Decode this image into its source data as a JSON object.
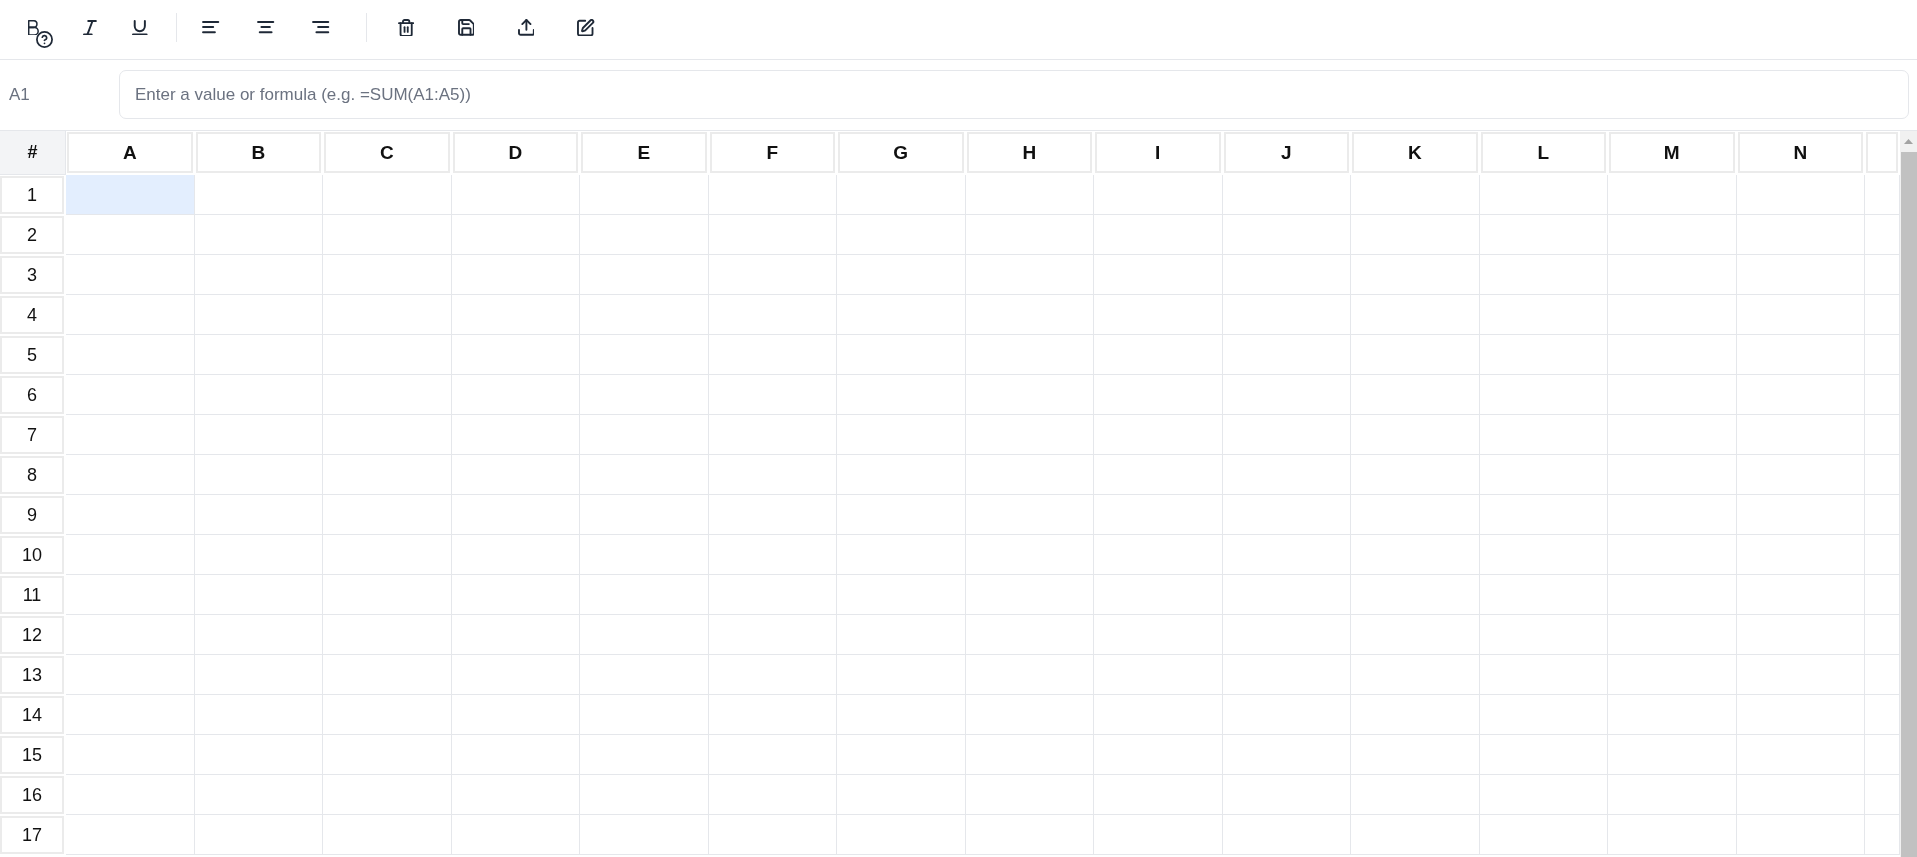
{
  "toolbar": {
    "groups": [
      {
        "buttons": [
          {
            "kind": "bold"
          },
          {
            "kind": "italic"
          },
          {
            "kind": "underline"
          }
        ]
      },
      {
        "buttons": [
          {
            "kind": "align-left"
          },
          {
            "kind": "align-center"
          },
          {
            "kind": "align-right"
          }
        ]
      },
      {
        "buttons": [
          {
            "kind": "delete"
          },
          {
            "kind": "save"
          },
          {
            "kind": "export"
          },
          {
            "kind": "edit"
          }
        ]
      }
    ]
  },
  "formula_bar": {
    "cell_reference": "A1",
    "placeholder": "Enter a value or formula (e.g. =SUM(A1:A5))"
  },
  "grid": {
    "corner": "#",
    "columns": [
      "A",
      "B",
      "C",
      "D",
      "E",
      "F",
      "G",
      "H",
      "I",
      "J",
      "K",
      "L",
      "M",
      "N"
    ],
    "rows": [
      {
        "label": "1",
        "cells": [
          {
            "selected": true
          },
          {
            "selected": false
          },
          {
            "selected": false
          },
          {
            "selected": false
          },
          {
            "selected": false
          },
          {
            "selected": false
          },
          {
            "selected": false
          },
          {
            "selected": false
          },
          {
            "selected": false
          },
          {
            "selected": false
          },
          {
            "selected": false
          },
          {
            "selected": false
          },
          {
            "selected": false
          },
          {
            "selected": false
          }
        ]
      },
      {
        "label": "2",
        "cells": [
          {
            "selected": false
          },
          {
            "selected": false
          },
          {
            "selected": false
          },
          {
            "selected": false
          },
          {
            "selected": false
          },
          {
            "selected": false
          },
          {
            "selected": false
          },
          {
            "selected": false
          },
          {
            "selected": false
          },
          {
            "selected": false
          },
          {
            "selected": false
          },
          {
            "selected": false
          },
          {
            "selected": false
          },
          {
            "selected": false
          }
        ]
      },
      {
        "label": "3",
        "cells": [
          {
            "selected": false
          },
          {
            "selected": false
          },
          {
            "selected": false
          },
          {
            "selected": false
          },
          {
            "selected": false
          },
          {
            "selected": false
          },
          {
            "selected": false
          },
          {
            "selected": false
          },
          {
            "selected": false
          },
          {
            "selected": false
          },
          {
            "selected": false
          },
          {
            "selected": false
          },
          {
            "selected": false
          },
          {
            "selected": false
          }
        ]
      },
      {
        "label": "4",
        "cells": [
          {
            "selected": false
          },
          {
            "selected": false
          },
          {
            "selected": false
          },
          {
            "selected": false
          },
          {
            "selected": false
          },
          {
            "selected": false
          },
          {
            "selected": false
          },
          {
            "selected": false
          },
          {
            "selected": false
          },
          {
            "selected": false
          },
          {
            "selected": false
          },
          {
            "selected": false
          },
          {
            "selected": false
          },
          {
            "selected": false
          }
        ]
      },
      {
        "label": "5",
        "cells": [
          {
            "selected": false
          },
          {
            "selected": false
          },
          {
            "selected": false
          },
          {
            "selected": false
          },
          {
            "selected": false
          },
          {
            "selected": false
          },
          {
            "selected": false
          },
          {
            "selected": false
          },
          {
            "selected": false
          },
          {
            "selected": false
          },
          {
            "selected": false
          },
          {
            "selected": false
          },
          {
            "selected": false
          },
          {
            "selected": false
          }
        ]
      },
      {
        "label": "6",
        "cells": [
          {
            "selected": false
          },
          {
            "selected": false
          },
          {
            "selected": false
          },
          {
            "selected": false
          },
          {
            "selected": false
          },
          {
            "selected": false
          },
          {
            "selected": false
          },
          {
            "selected": false
          },
          {
            "selected": false
          },
          {
            "selected": false
          },
          {
            "selected": false
          },
          {
            "selected": false
          },
          {
            "selected": false
          },
          {
            "selected": false
          }
        ]
      },
      {
        "label": "7",
        "cells": [
          {
            "selected": false
          },
          {
            "selected": false
          },
          {
            "selected": false
          },
          {
            "selected": false
          },
          {
            "selected": false
          },
          {
            "selected": false
          },
          {
            "selected": false
          },
          {
            "selected": false
          },
          {
            "selected": false
          },
          {
            "selected": false
          },
          {
            "selected": false
          },
          {
            "selected": false
          },
          {
            "selected": false
          },
          {
            "selected": false
          }
        ]
      },
      {
        "label": "8",
        "cells": [
          {
            "selected": false
          },
          {
            "selected": false
          },
          {
            "selected": false
          },
          {
            "selected": false
          },
          {
            "selected": false
          },
          {
            "selected": false
          },
          {
            "selected": false
          },
          {
            "selected": false
          },
          {
            "selected": false
          },
          {
            "selected": false
          },
          {
            "selected": false
          },
          {
            "selected": false
          },
          {
            "selected": false
          },
          {
            "selected": false
          }
        ]
      },
      {
        "label": "9",
        "cells": [
          {
            "selected": false
          },
          {
            "selected": false
          },
          {
            "selected": false
          },
          {
            "selected": false
          },
          {
            "selected": false
          },
          {
            "selected": false
          },
          {
            "selected": false
          },
          {
            "selected": false
          },
          {
            "selected": false
          },
          {
            "selected": false
          },
          {
            "selected": false
          },
          {
            "selected": false
          },
          {
            "selected": false
          },
          {
            "selected": false
          }
        ]
      },
      {
        "label": "10",
        "cells": [
          {
            "selected": false
          },
          {
            "selected": false
          },
          {
            "selected": false
          },
          {
            "selected": false
          },
          {
            "selected": false
          },
          {
            "selected": false
          },
          {
            "selected": false
          },
          {
            "selected": false
          },
          {
            "selected": false
          },
          {
            "selected": false
          },
          {
            "selected": false
          },
          {
            "selected": false
          },
          {
            "selected": false
          },
          {
            "selected": false
          }
        ]
      },
      {
        "label": "11",
        "cells": [
          {
            "selected": false
          },
          {
            "selected": false
          },
          {
            "selected": false
          },
          {
            "selected": false
          },
          {
            "selected": false
          },
          {
            "selected": false
          },
          {
            "selected": false
          },
          {
            "selected": false
          },
          {
            "selected": false
          },
          {
            "selected": false
          },
          {
            "selected": false
          },
          {
            "selected": false
          },
          {
            "selected": false
          },
          {
            "selected": false
          }
        ]
      },
      {
        "label": "12",
        "cells": [
          {
            "selected": false
          },
          {
            "selected": false
          },
          {
            "selected": false
          },
          {
            "selected": false
          },
          {
            "selected": false
          },
          {
            "selected": false
          },
          {
            "selected": false
          },
          {
            "selected": false
          },
          {
            "selected": false
          },
          {
            "selected": false
          },
          {
            "selected": false
          },
          {
            "selected": false
          },
          {
            "selected": false
          },
          {
            "selected": false
          }
        ]
      },
      {
        "label": "13",
        "cells": [
          {
            "selected": false
          },
          {
            "selected": false
          },
          {
            "selected": false
          },
          {
            "selected": false
          },
          {
            "selected": false
          },
          {
            "selected": false
          },
          {
            "selected": false
          },
          {
            "selected": false
          },
          {
            "selected": false
          },
          {
            "selected": false
          },
          {
            "selected": false
          },
          {
            "selected": false
          },
          {
            "selected": false
          },
          {
            "selected": false
          }
        ]
      },
      {
        "label": "14",
        "cells": [
          {
            "selected": false
          },
          {
            "selected": false
          },
          {
            "selected": false
          },
          {
            "selected": false
          },
          {
            "selected": false
          },
          {
            "selected": false
          },
          {
            "selected": false
          },
          {
            "selected": false
          },
          {
            "selected": false
          },
          {
            "selected": false
          },
          {
            "selected": false
          },
          {
            "selected": false
          },
          {
            "selected": false
          },
          {
            "selected": false
          }
        ]
      },
      {
        "label": "15",
        "cells": [
          {
            "selected": false
          },
          {
            "selected": false
          },
          {
            "selected": false
          },
          {
            "selected": false
          },
          {
            "selected": false
          },
          {
            "selected": false
          },
          {
            "selected": false
          },
          {
            "selected": false
          },
          {
            "selected": false
          },
          {
            "selected": false
          },
          {
            "selected": false
          },
          {
            "selected": false
          },
          {
            "selected": false
          },
          {
            "selected": false
          }
        ]
      },
      {
        "label": "16",
        "cells": [
          {
            "selected": false
          },
          {
            "selected": false
          },
          {
            "selected": false
          },
          {
            "selected": false
          },
          {
            "selected": false
          },
          {
            "selected": false
          },
          {
            "selected": false
          },
          {
            "selected": false
          },
          {
            "selected": false
          },
          {
            "selected": false
          },
          {
            "selected": false
          },
          {
            "selected": false
          },
          {
            "selected": false
          },
          {
            "selected": false
          }
        ]
      },
      {
        "label": "17",
        "cells": [
          {
            "selected": false
          },
          {
            "selected": false
          },
          {
            "selected": false
          },
          {
            "selected": false
          },
          {
            "selected": false
          },
          {
            "selected": false
          },
          {
            "selected": false
          },
          {
            "selected": false
          },
          {
            "selected": false
          },
          {
            "selected": false
          },
          {
            "selected": false
          },
          {
            "selected": false
          },
          {
            "selected": false
          },
          {
            "selected": false
          }
        ]
      }
    ]
  }
}
